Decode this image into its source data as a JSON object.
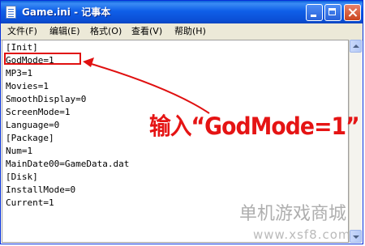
{
  "window": {
    "title": "Game.ini - 记事本",
    "controls": {
      "minimize_icon": "minimize-icon",
      "maximize_icon": "maximize-icon",
      "close_icon": "close-icon"
    },
    "accent": "#0b4fd6"
  },
  "menubar": {
    "items": [
      {
        "label": "文件(F)"
      },
      {
        "label": "编辑(E)"
      },
      {
        "label": "格式(O)"
      },
      {
        "label": "查看(V)"
      },
      {
        "label": "帮助(H)"
      }
    ]
  },
  "editor": {
    "lines": [
      "[Init]",
      "GodMode=1",
      "MP3=1",
      "Movies=1",
      "SmoothDisplay=0",
      "ScreenMode=1",
      "Language=0",
      "[Package]",
      "Num=1",
      "MainDate00=GameData.dat",
      "[Disk]",
      "InstallMode=0",
      "Current=1"
    ]
  },
  "annotation": {
    "text": "输入“GodMode=1”",
    "color": "#e51414"
  },
  "watermark": {
    "site_name": "单机游戏商城",
    "url": "www.xsf8.com"
  }
}
